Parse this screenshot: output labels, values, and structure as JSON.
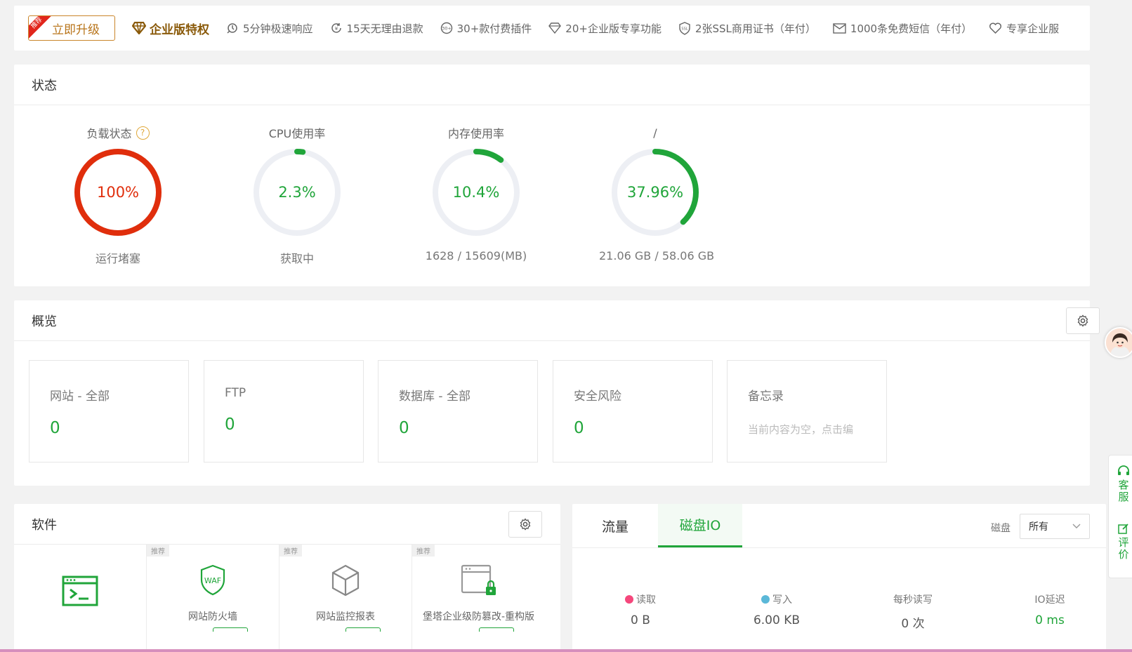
{
  "topbar": {
    "upgrade_badge": "推荐",
    "upgrade_label": "立即升级",
    "enterprise_label": "企业版特权",
    "perks": [
      "5分钟极速响应",
      "15天无理由退款",
      "30+款付费插件",
      "20+企业版专享功能",
      "2张SSL商用证书（年付）",
      "1000条免费短信（年付）",
      "专享企业服"
    ]
  },
  "status": {
    "title": "状态",
    "load": {
      "title": "负载状态",
      "value": "100%",
      "percent": 100,
      "sub": "运行堵塞",
      "color": "#e02e0c"
    },
    "cpu": {
      "title": "CPU使用率",
      "value": "2.3%",
      "percent": 2.3,
      "sub": "获取中",
      "color": "#20a53a"
    },
    "mem": {
      "title": "内存使用率",
      "value": "10.4%",
      "percent": 10.4,
      "sub": "1628 / 15609(MB)",
      "color": "#20a53a"
    },
    "disk": {
      "title": "/",
      "value": "37.96%",
      "percent": 37.96,
      "sub": "21.06 GB / 58.06 GB",
      "color": "#20a53a"
    }
  },
  "overview": {
    "title": "概览",
    "items": [
      {
        "label": "网站 - 全部",
        "value": "0"
      },
      {
        "label": "FTP",
        "value": "0"
      },
      {
        "label": "数据库 - 全部",
        "value": "0"
      },
      {
        "label": "安全风险",
        "value": "0"
      }
    ],
    "memo": {
      "label": "备忘录",
      "placeholder": "当前内容为空，点击编"
    }
  },
  "software": {
    "title": "软件",
    "tiles": [
      {
        "name": "",
        "badge": "",
        "icon": "terminal-icon"
      },
      {
        "name": "网站防火墙",
        "badge": "推荐",
        "icon": "waf-shield-icon"
      },
      {
        "name": "网站监控报表",
        "badge": "推荐",
        "icon": "cube-icon"
      },
      {
        "name": "堡塔企业级防篡改-重构版",
        "badge": "推荐",
        "icon": "window-lock-icon"
      }
    ]
  },
  "io": {
    "tabs": [
      "流量",
      "磁盘IO"
    ],
    "active_tab": "磁盘IO",
    "disk_label": "磁盘",
    "disk_select": "所有",
    "stats": [
      {
        "label": "读取",
        "value": "0 B",
        "dot": "#f5477c"
      },
      {
        "label": "写入",
        "value": "6.00 KB",
        "dot": "#5bb8d8"
      },
      {
        "label": "每秒读写",
        "value": "0 次",
        "dot": ""
      },
      {
        "label": "IO延迟",
        "value": "0 ms",
        "dot": ""
      }
    ]
  },
  "side": {
    "service": "客服",
    "review": "评价"
  }
}
